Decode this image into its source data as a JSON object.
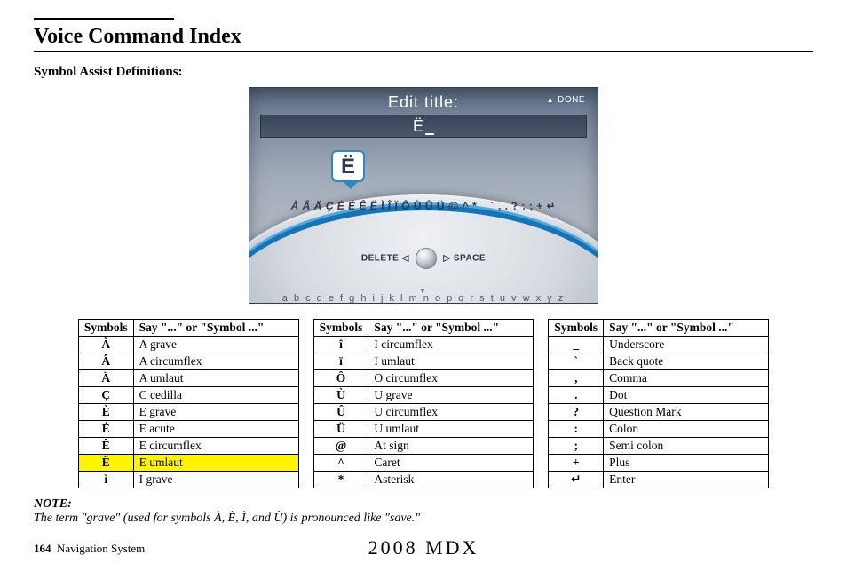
{
  "header": {
    "title": "Voice Command Index",
    "subhead": "Symbol Assist Definitions:"
  },
  "nav_screen": {
    "title": "Edit title:",
    "done": "DONE",
    "input": "Ë",
    "bubble": "Ë",
    "arc_chars": "À Â Ä Ç È É Ê Ë Ì Î Ï Ô Ù Û Ü @ ^ * _ ` , . ? : ; + ↵",
    "delete_label": "DELETE ◁",
    "space_label": "▷ SPACE",
    "alpha_strip": "a b c d e f g h i j k l m n o p q r s t u v w x y z"
  },
  "table_headers": {
    "symbols": "Symbols",
    "say": "Say \"...\" or \"Symbol ...\""
  },
  "table1": [
    {
      "sym": "À",
      "say": "A grave"
    },
    {
      "sym": "Â",
      "say": "A circumflex"
    },
    {
      "sym": "Ä",
      "say": "A umlaut"
    },
    {
      "sym": "Ç",
      "say": "C cedilla"
    },
    {
      "sym": "È",
      "say": "E grave"
    },
    {
      "sym": "É",
      "say": "E acute"
    },
    {
      "sym": "Ê",
      "say": "E circumflex"
    },
    {
      "sym": "Ë",
      "say": "E umlaut",
      "highlight": true
    },
    {
      "sym": "ì",
      "say": "I grave"
    }
  ],
  "table2": [
    {
      "sym": "î",
      "say": "I circumflex"
    },
    {
      "sym": "ï",
      "say": "I umlaut"
    },
    {
      "sym": "Ô",
      "say": "O circumflex"
    },
    {
      "sym": "Ù",
      "say": "U grave"
    },
    {
      "sym": "Û",
      "say": "U circumflex"
    },
    {
      "sym": "Ü",
      "say": "U umlaut"
    },
    {
      "sym": "@",
      "say": "At sign"
    },
    {
      "sym": "^",
      "say": "Caret"
    },
    {
      "sym": "*",
      "say": "Asterisk"
    }
  ],
  "table3": [
    {
      "sym": "_",
      "say": "Underscore"
    },
    {
      "sym": "`",
      "say": "Back quote"
    },
    {
      "sym": ",",
      "say": "Comma"
    },
    {
      "sym": ".",
      "say": "Dot"
    },
    {
      "sym": "?",
      "say": "Question Mark"
    },
    {
      "sym": ":",
      "say": "Colon"
    },
    {
      "sym": ";",
      "say": "Semi colon"
    },
    {
      "sym": "+",
      "say": "Plus"
    },
    {
      "sym": "↵",
      "say": "Enter"
    }
  ],
  "note": {
    "label": "NOTE:",
    "body": "The term \"grave\" (used for symbols À, È, Ì, and Ù) is pronounced like \"save.\""
  },
  "footer": {
    "page": "164",
    "section": "Navigation System",
    "model": "2008  MDX"
  }
}
